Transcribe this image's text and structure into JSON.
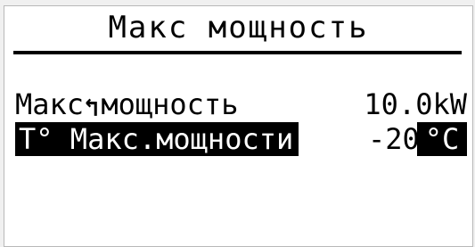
{
  "screen": {
    "title": "Макс мощность",
    "back_icon": "↰",
    "rows": {
      "max_power": {
        "label": "Макс мощность",
        "value": "10.0kW"
      },
      "temp_max_power": {
        "label": "T° Макс.мощности",
        "value": "-20",
        "unit": "°C"
      }
    }
  }
}
